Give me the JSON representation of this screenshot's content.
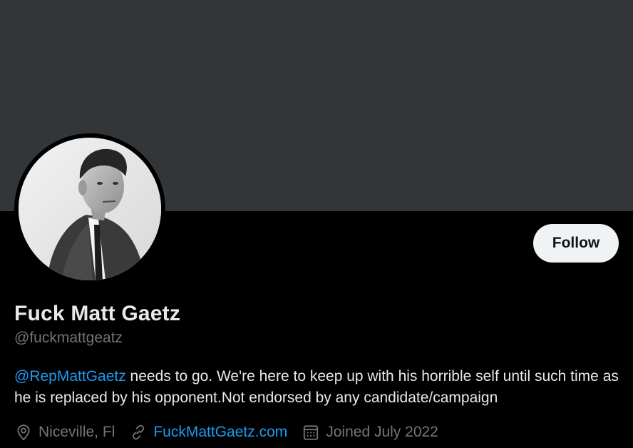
{
  "profile": {
    "display_name": "Fuck Matt Gaetz",
    "handle": "@fuckmattgeatz",
    "bio": {
      "mention": "@RepMattGaetz",
      "text": " needs to go. We're here to keep up with his horrible self until such time as he is replaced by his opponent.Not endorsed by any candidate/campaign"
    },
    "location": "Niceville, Fl",
    "website": "FuckMattGaetz.com",
    "joined": "Joined July 2022"
  },
  "actions": {
    "follow_label": "Follow"
  },
  "icons": {
    "location": "location-pin-icon",
    "website": "link-icon",
    "joined": "calendar-icon"
  },
  "colors": {
    "background": "#000000",
    "banner": "#333639",
    "primary_text": "#e7e9ea",
    "secondary_text": "#71767b",
    "link": "#1d9bf0",
    "follow_button_bg": "#eff3f4",
    "follow_button_text": "#0f1419"
  }
}
